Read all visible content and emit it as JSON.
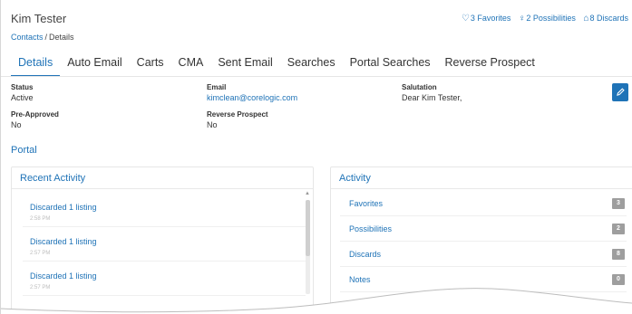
{
  "header": {
    "title": "Kim Tester",
    "breadcrumb": {
      "parent": "Contacts",
      "separator": "/",
      "current": "Details"
    },
    "summary": [
      {
        "icon": "heart-icon",
        "glyph": "♡",
        "label": "3 Favorites"
      },
      {
        "icon": "lightbulb-icon",
        "glyph": "♀",
        "label": "2 Possibilities"
      },
      {
        "icon": "trash-icon",
        "glyph": "⌂",
        "label": "8 Discards"
      }
    ]
  },
  "tabs": [
    {
      "label": "Details",
      "active": true
    },
    {
      "label": "Auto Email",
      "active": false
    },
    {
      "label": "Carts",
      "active": false
    },
    {
      "label": "CMA",
      "active": false
    },
    {
      "label": "Sent Email",
      "active": false
    },
    {
      "label": "Searches",
      "active": false
    },
    {
      "label": "Portal Searches",
      "active": false
    },
    {
      "label": "Reverse Prospect",
      "active": false
    }
  ],
  "details": {
    "status": {
      "label": "Status",
      "value": "Active"
    },
    "email": {
      "label": "Email",
      "value": "kimclean@corelogic.com"
    },
    "salutation": {
      "label": "Salutation",
      "value": "Dear Kim Tester,"
    },
    "pre_approved": {
      "label": "Pre-Approved",
      "value": "No"
    },
    "reverse_prospect": {
      "label": "Reverse Prospect",
      "value": "No"
    }
  },
  "edit_icon": "pencil-icon",
  "portal": {
    "title": "Portal"
  },
  "recent_activity": {
    "title": "Recent Activity",
    "items": [
      {
        "text": "Discarded 1 listing",
        "time": "2:58 PM"
      },
      {
        "text": "Discarded 1 listing",
        "time": "2:57 PM"
      },
      {
        "text": "Discarded 1 listing",
        "time": "2:57 PM"
      }
    ]
  },
  "activity": {
    "title": "Activity",
    "items": [
      {
        "label": "Favorites",
        "count": "3"
      },
      {
        "label": "Possibilities",
        "count": "2"
      },
      {
        "label": "Discards",
        "count": "8"
      },
      {
        "label": "Notes",
        "count": "0"
      }
    ]
  },
  "colors": {
    "accent": "#1f73b7",
    "badge": "#9e9e9e"
  }
}
